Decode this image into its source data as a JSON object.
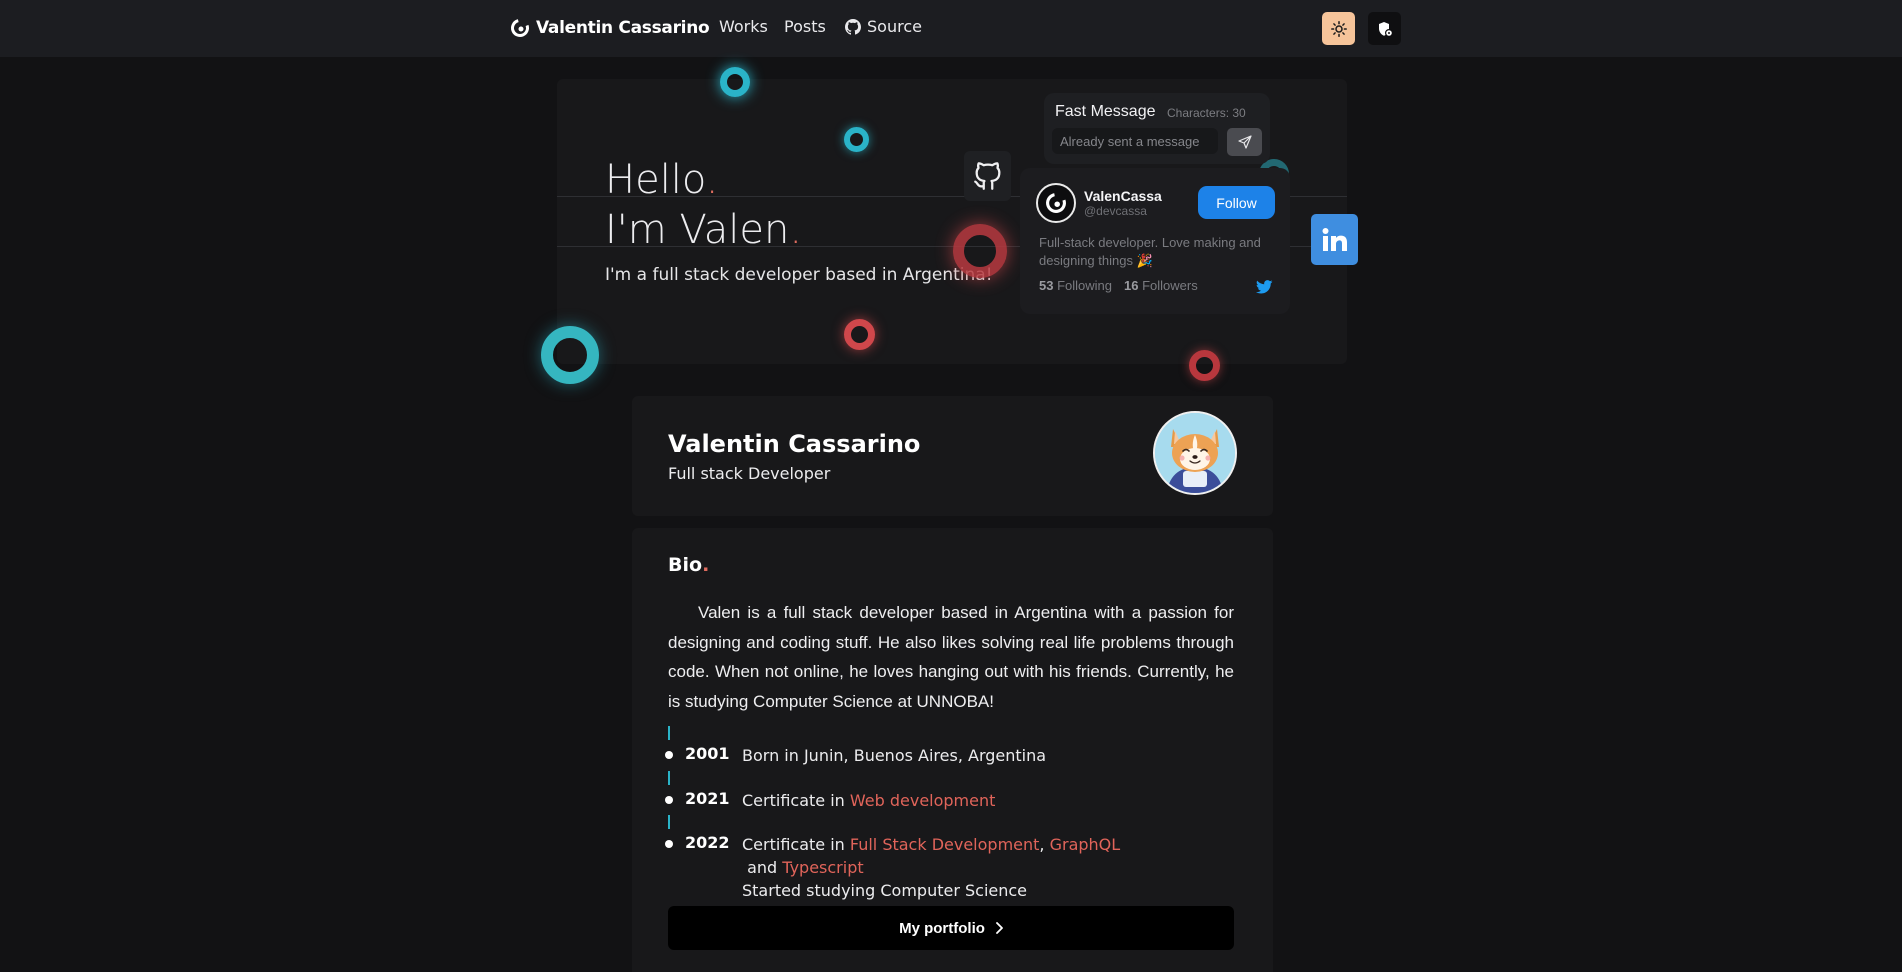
{
  "navbar": {
    "brand": "Valentin Cassarino",
    "links": {
      "works": "Works",
      "posts": "Posts",
      "source": "Source"
    }
  },
  "hero": {
    "hello": "Hello",
    "greeting": "I'm Valen",
    "dot": ".",
    "subtitle": "I'm a full stack developer based in Argentina!"
  },
  "fast_message": {
    "title": "Fast Message",
    "characters": "Characters: 30",
    "placeholder": "Already sent a message"
  },
  "twitter_card": {
    "name": "ValenCassa",
    "handle": "@devcassa",
    "follow_label": "Follow",
    "bio": "Full-stack developer. Love making and designing things 🎉",
    "following_count": "53",
    "following_label": "Following",
    "followers_count": "16",
    "followers_label": "Followers"
  },
  "profile": {
    "name": "Valentin Cassarino",
    "role": "Full stack Developer"
  },
  "bio": {
    "heading": "Bio",
    "dot": ".",
    "text": "Valen is a full stack developer based in Argentina with a passion for designing and coding stuff. He also likes solving real life problems through code. When not online, he loves hanging out with his friends. Currently, he is studying Computer Science at UNNOBA!",
    "timeline": [
      {
        "year": "2001",
        "text": "Born in Junin, Buenos Aires, Argentina"
      },
      {
        "year": "2021",
        "prefix": "Certificate in ",
        "link": "Web development"
      },
      {
        "year": "2022",
        "prefix": "Certificate in ",
        "link1": "Full Stack Development",
        "sep1": ", ",
        "link2": "GraphQL",
        "sep2": " and ",
        "link3": "Typescript",
        "line2": "Started studying Computer Science"
      }
    ],
    "portfolio_label": "My portfolio"
  },
  "colors": {
    "accent": "#e06c5f",
    "teal": "#2ab3c8",
    "follow_blue": "#1d82e8",
    "linkedin_blue": "#3f8ee0",
    "theme_button": "#f6c49a"
  }
}
